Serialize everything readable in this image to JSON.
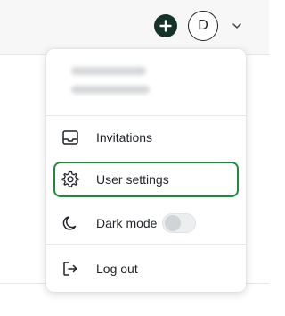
{
  "header": {
    "avatar_initial": "D",
    "add_icon": "plus-circle-icon",
    "caret_icon": "chevron-down-icon"
  },
  "menu": {
    "user_name": "",
    "user_email": "",
    "items": [
      {
        "label": "Invitations",
        "icon": "inbox-icon"
      },
      {
        "label": "User settings",
        "icon": "gear-icon",
        "highlighted": true
      },
      {
        "label": "Dark mode",
        "icon": "moon-icon",
        "toggle_on": false
      },
      {
        "label": "Log out",
        "icon": "logout-icon"
      }
    ]
  },
  "colors": {
    "accent_dark_green": "#16332a",
    "highlight_green": "#1f8a3c"
  }
}
